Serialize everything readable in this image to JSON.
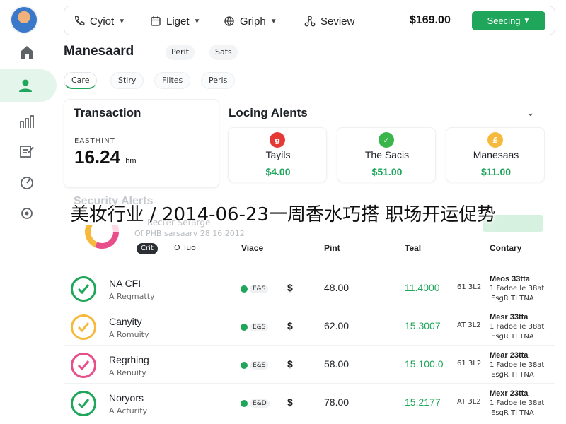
{
  "colors": {
    "accent": "#1fa65a",
    "red": "#e53935",
    "orange": "#f6b93b",
    "pink": "#e84e8a"
  },
  "sidebar": {
    "items": [
      {
        "icon": "home-icon"
      },
      {
        "icon": "user-icon",
        "active": true
      },
      {
        "icon": "chart-icon"
      },
      {
        "icon": "edit-icon"
      },
      {
        "icon": "gauge-icon"
      },
      {
        "icon": "settings-icon"
      }
    ]
  },
  "header": {
    "nav": [
      {
        "label": "Cyiot",
        "icon": "phone-icon"
      },
      {
        "label": "Liget",
        "icon": "calendar-icon"
      },
      {
        "label": "Griph",
        "icon": "globe-icon"
      },
      {
        "label": "Seview",
        "icon": "network-icon"
      }
    ],
    "price": "$169.00",
    "settings_label": "Seecing"
  },
  "page": {
    "title": "Manesaard",
    "pills": [
      "Perit",
      "Sats"
    ],
    "tabs": [
      "Care",
      "Stiry",
      "Flites",
      "Peris"
    ]
  },
  "transaction": {
    "title": "Transaction",
    "label": "EASTHINT",
    "value": "16.24",
    "unit": "hm"
  },
  "alerts": {
    "title": "Locing Alents",
    "items": [
      {
        "name": "Tayils",
        "amount": "$4.00",
        "symbol": "g",
        "color": "#e53935"
      },
      {
        "name": "The Sacis",
        "amount": "$51.00",
        "symbol": "✓",
        "color": "#3ab54a"
      },
      {
        "name": "Manesaas",
        "amount": "$11.00",
        "symbol": "£",
        "color": "#f6b93b"
      }
    ]
  },
  "security": {
    "title": "Security Alerts",
    "subtitle": "Recter Setarge",
    "meta": "Of PHB sarsaary 28 16 2012",
    "toggle_a": "Crit",
    "toggle_b": "O Tuo"
  },
  "caption": "美妆行业 / 2014-06-23一周香水巧搭 职场开运促势",
  "table": {
    "headers": [
      "Viace",
      "Pint",
      "Teal",
      "Contary"
    ],
    "rows": [
      {
        "name": "NA CFI",
        "sub": "A Regmatty",
        "status": "E&S",
        "currency": "$",
        "price": "48.00",
        "total": "11.4000",
        "meta": "61 3L2",
        "contact_a": "Meos 33tta",
        "contact_b": "1 Fadoe Ie 38at",
        "contact_c": "EsgR TI TNA",
        "color": "#1fa65a"
      },
      {
        "name": "Canyity",
        "sub": "A Romuity",
        "status": "E&S",
        "currency": "$",
        "price": "62.00",
        "total": "15.3007",
        "meta": "AT 3L2",
        "contact_a": "Mesr 33tta",
        "contact_b": "1 Fadoe Ie 38at",
        "contact_c": "EsgR TI TNA",
        "color": "#f6b93b"
      },
      {
        "name": "Regrhing",
        "sub": "A Renuity",
        "status": "E&S",
        "currency": "$",
        "price": "58.00",
        "total": "15.100.0",
        "meta": "61 3L2",
        "contact_a": "Mear 23tta",
        "contact_b": "1 Fadoe Ie 38at",
        "contact_c": "EsgR TI TNA",
        "color": "#e84e8a"
      },
      {
        "name": "Noryors",
        "sub": "A Acturity",
        "status": "E&D",
        "currency": "$",
        "price": "78.00",
        "total": "15.2177",
        "meta": "AT 3L2",
        "contact_a": "Mexr 23tta",
        "contact_b": "1 Fadoe Ie 38at",
        "contact_c": "EsgR TI TNA",
        "color": "#1fa65a"
      }
    ]
  }
}
